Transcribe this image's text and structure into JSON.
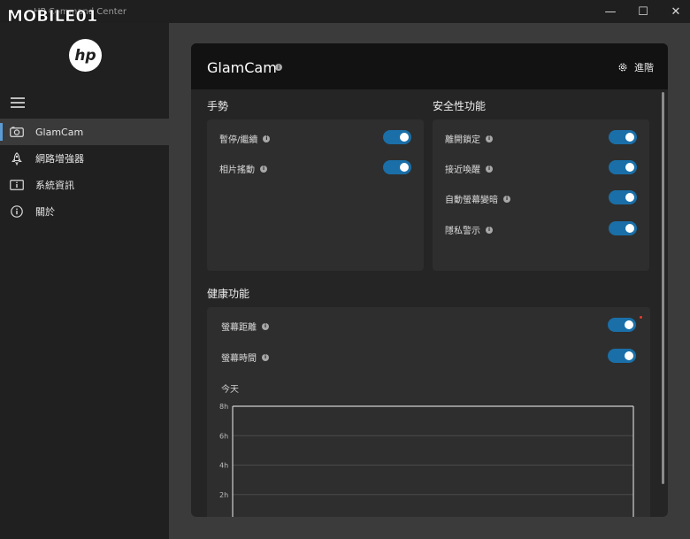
{
  "window": {
    "app_title": "HP Command Center",
    "minimize": "—",
    "maximize": "☐",
    "close": "✕"
  },
  "watermark": "MOBILE01",
  "sidebar": {
    "logo": "hp",
    "items": [
      {
        "label": "GlamCam",
        "icon": "camera-icon",
        "active": true
      },
      {
        "label": "網路增強器",
        "icon": "rocket-icon",
        "active": false
      },
      {
        "label": "系統資訊",
        "icon": "system-info-icon",
        "active": false
      },
      {
        "label": "關於",
        "icon": "about-icon",
        "active": false
      }
    ]
  },
  "panel": {
    "title": "GlamCam",
    "advanced_label": "進階"
  },
  "gestures": {
    "title": "手勢",
    "rows": [
      {
        "label": "暫停/繼續",
        "on": true
      },
      {
        "label": "相片搖動",
        "on": true
      }
    ]
  },
  "security": {
    "title": "安全性功能",
    "rows": [
      {
        "label": "離開鎖定",
        "on": true
      },
      {
        "label": "接近喚醒",
        "on": true
      },
      {
        "label": "自動螢幕變暗",
        "on": true
      },
      {
        "label": "隱私警示",
        "on": true
      }
    ]
  },
  "health": {
    "title": "健康功能",
    "rows": [
      {
        "label": "螢幕距離",
        "on": true
      },
      {
        "label": "螢幕時間",
        "on": true
      }
    ],
    "today_label": "今天"
  },
  "chart_data": {
    "type": "bar",
    "title": "",
    "xlabel": "",
    "ylabel": "",
    "y_ticks": [
      "8h",
      "6h",
      "4h",
      "2h"
    ],
    "ylim": [
      0,
      8
    ],
    "grid": true,
    "categories": [],
    "values": []
  },
  "colors": {
    "toggle_on": "#1a6fa8",
    "accent": "#5b9bd5",
    "alert": "#e53935"
  }
}
